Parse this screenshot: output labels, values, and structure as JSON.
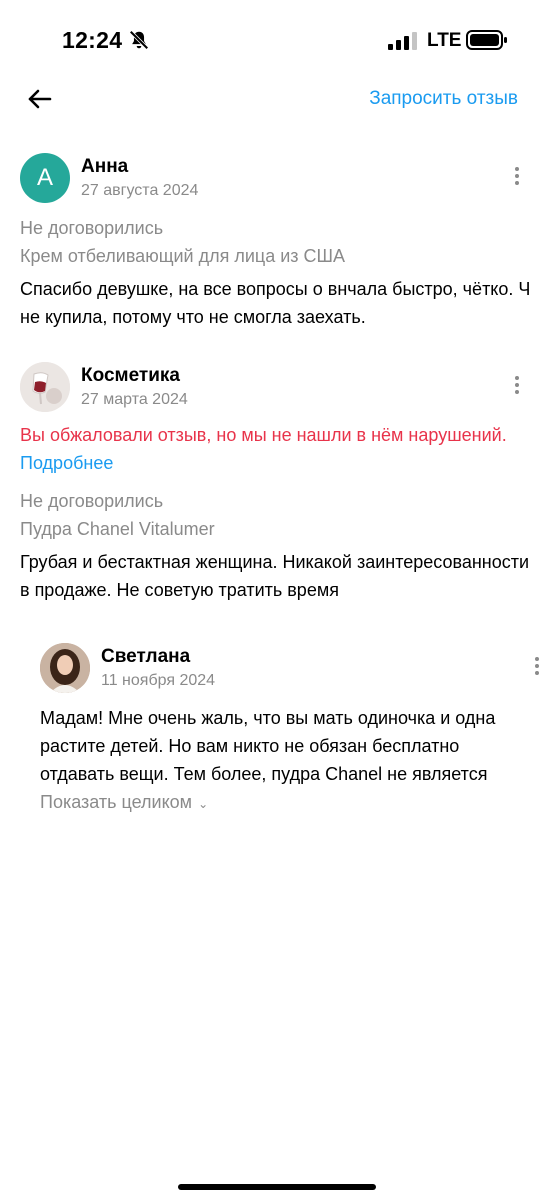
{
  "status_bar": {
    "time": "12:24",
    "network": "LTE"
  },
  "header": {
    "request_review_label": "Запросить отзыв"
  },
  "reviews": [
    {
      "avatar_letter": "А",
      "author": "Анна",
      "date": "27 августа 2024",
      "deal_status": "Не договорились",
      "item": "Крем отбеливающий для лица из США",
      "text": "Спасибо девушке, на все вопросы о внчала быстро, чётко. Ч не купила, потому что не смогла заехать."
    },
    {
      "author": "Косметика",
      "date": "27 марта 2024",
      "appeal_notice": "Вы обжаловали отзыв, но мы не нашли в нём нарушений.",
      "details_link": "Подробнее",
      "deal_status": "Не договорились",
      "item": "Пудра Chanel Vitalumer",
      "text": "Грубая и бестактная женщина. Никакой заинтересованности в продаже. Не советую тратить время",
      "reply": {
        "author": "Светлана",
        "date": "11 ноября 2024",
        "text": "Мадам! Мне очень жаль, что вы мать одиночка и одна растите детей. Но вам никто не обязан бесплатно отдавать вещи.  Тем более, пудра Chanel не является",
        "show_full_label": "Показать целиком"
      }
    }
  ],
  "colors": {
    "accent": "#1a9bf0",
    "warning": "#e8334a",
    "avatar_bg": "#25a89a",
    "muted": "#8a8a8a"
  }
}
